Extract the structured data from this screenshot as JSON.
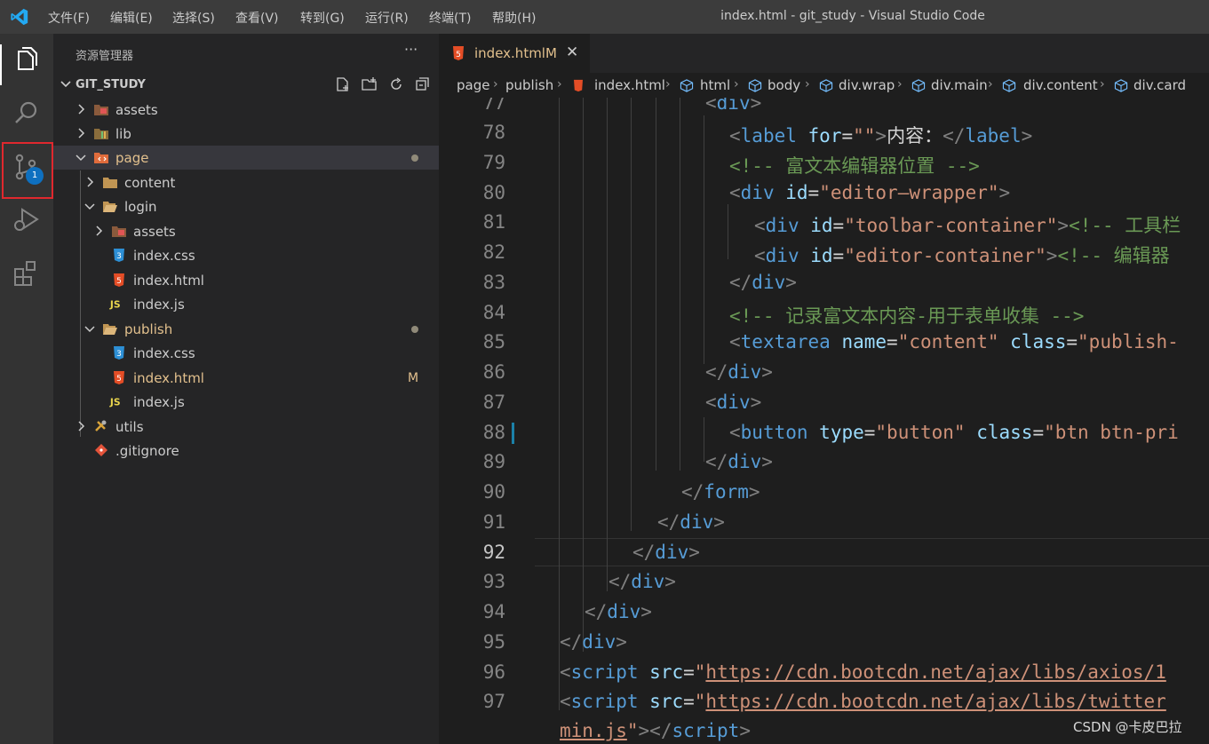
{
  "titlebar": {
    "menu": [
      "文件(F)",
      "编辑(E)",
      "选择(S)",
      "查看(V)",
      "转到(G)",
      "运行(R)",
      "终端(T)",
      "帮助(H)"
    ],
    "window_title": "index.html - git_study - Visual Studio Code"
  },
  "activity_bar": {
    "icons": [
      "explorer-icon",
      "search-icon",
      "source-control-icon",
      "run-debug-icon",
      "extensions-icon"
    ],
    "scm_badge": "1"
  },
  "sidebar": {
    "title": "资源管理器",
    "more": "···",
    "project": "GIT_STUDY",
    "tree": [
      {
        "label": "assets",
        "type": "folder",
        "expanded": false
      },
      {
        "label": "lib",
        "type": "folder",
        "expanded": false
      },
      {
        "label": "page",
        "type": "folder",
        "expanded": true
      },
      {
        "label": "content",
        "type": "folder",
        "expanded": false
      },
      {
        "label": "login",
        "type": "folder",
        "expanded": true
      },
      {
        "label": "assets",
        "type": "folder",
        "expanded": false
      },
      {
        "label": "index.css",
        "type": "css"
      },
      {
        "label": "index.html",
        "type": "html"
      },
      {
        "label": "index.js",
        "type": "js"
      },
      {
        "label": "publish",
        "type": "folder",
        "expanded": true
      },
      {
        "label": "index.css",
        "type": "css"
      },
      {
        "label": "index.html",
        "type": "html",
        "status": "M"
      },
      {
        "label": "index.js",
        "type": "js"
      },
      {
        "label": "utils",
        "type": "folder",
        "expanded": false
      },
      {
        "label": ".gitignore",
        "type": "git"
      }
    ]
  },
  "editor": {
    "tab": {
      "label": "index.html",
      "status": "M",
      "close": "✕"
    },
    "breadcrumb": [
      "page",
      "publish",
      "index.html",
      "html",
      "body",
      "div.wrap",
      "div.main",
      "div.content",
      "div.card"
    ],
    "line_numbers": [
      "77",
      "78",
      "79",
      "80",
      "81",
      "82",
      "83",
      "84",
      "85",
      "86",
      "87",
      "88",
      "89",
      "90",
      "91",
      "92",
      "93",
      "94",
      "95",
      "96",
      "97"
    ],
    "current_line": "92",
    "code": {
      "l77": {
        "open": "<",
        "tag": "div",
        "close": ">"
      },
      "l78": {
        "open": "<",
        "tag": "label",
        "attr": "for",
        "eq": "=",
        "val": "\"\"",
        "close": ">",
        "text": "内容：",
        "endopen": "</",
        "endtag": "label",
        "endclose": ">"
      },
      "l79": {
        "comment": "<!-- 富文本编辑器位置 -->"
      },
      "l80": {
        "open": "<",
        "tag": "div",
        "attr": "id",
        "eq": "=",
        "val": "\"editor—wrapper\"",
        "close": ">"
      },
      "l81": {
        "open": "<",
        "tag": "div",
        "attr": "id",
        "eq": "=",
        "val": "\"toolbar-container\"",
        "close": ">",
        "comment": "<!-- 工具栏"
      },
      "l82": {
        "open": "<",
        "tag": "div",
        "attr": "id",
        "eq": "=",
        "val": "\"editor-container\"",
        "close": ">",
        "comment": "<!-- 编辑器"
      },
      "l83": {
        "open": "</",
        "tag": "div",
        "close": ">"
      },
      "l84": {
        "comment": "<!-- 记录富文本内容-用于表单收集 -->"
      },
      "l85": {
        "open": "<",
        "tag": "textarea",
        "attr": "name",
        "eq": "=",
        "val": "\"content\"",
        "attr2": "class",
        "eq2": "=",
        "val2": "\"publish-"
      },
      "l86": {
        "open": "</",
        "tag": "div",
        "close": ">"
      },
      "l87": {
        "open": "<",
        "tag": "div",
        "close": ">"
      },
      "l88": {
        "open": "<",
        "tag": "button",
        "attr": "type",
        "eq": "=",
        "val": "\"button\"",
        "attr2": "class",
        "eq2": "=",
        "val2": "\"btn btn-pri"
      },
      "l89": {
        "open": "</",
        "tag": "div",
        "close": ">"
      },
      "l90": {
        "open": "</",
        "tag": "form",
        "close": ">"
      },
      "l91": {
        "open": "</",
        "tag": "div",
        "close": ">"
      },
      "l92": {
        "open": "</",
        "tag": "div",
        "close": ">"
      },
      "l93": {
        "open": "</",
        "tag": "div",
        "close": ">"
      },
      "l94": {
        "open": "</",
        "tag": "div",
        "close": ">"
      },
      "l95": {
        "open": "</",
        "tag": "div",
        "close": ">"
      },
      "l96": {
        "open": "<",
        "tag": "script",
        "attr": "src",
        "eq": "=",
        "q": "\"",
        "url": "https://cdn.bootcdn.net/ajax/libs/axios/1"
      },
      "l97": {
        "open": "<",
        "tag": "script",
        "attr": "src",
        "eq": "=",
        "q": "\"",
        "url": "https://cdn.bootcdn.net/ajax/libs/twitter"
      },
      "l97b": {
        "url": "min.js",
        "q": "\"",
        "close": ">",
        "endopen": "</",
        "endtag": "script",
        "endclose": ">"
      }
    }
  },
  "watermark": "CSDN @卡皮巴拉",
  "colors": {
    "accent": "#0e70c0",
    "modified": "#e2c08d",
    "highlight_box": "#e0282e"
  }
}
